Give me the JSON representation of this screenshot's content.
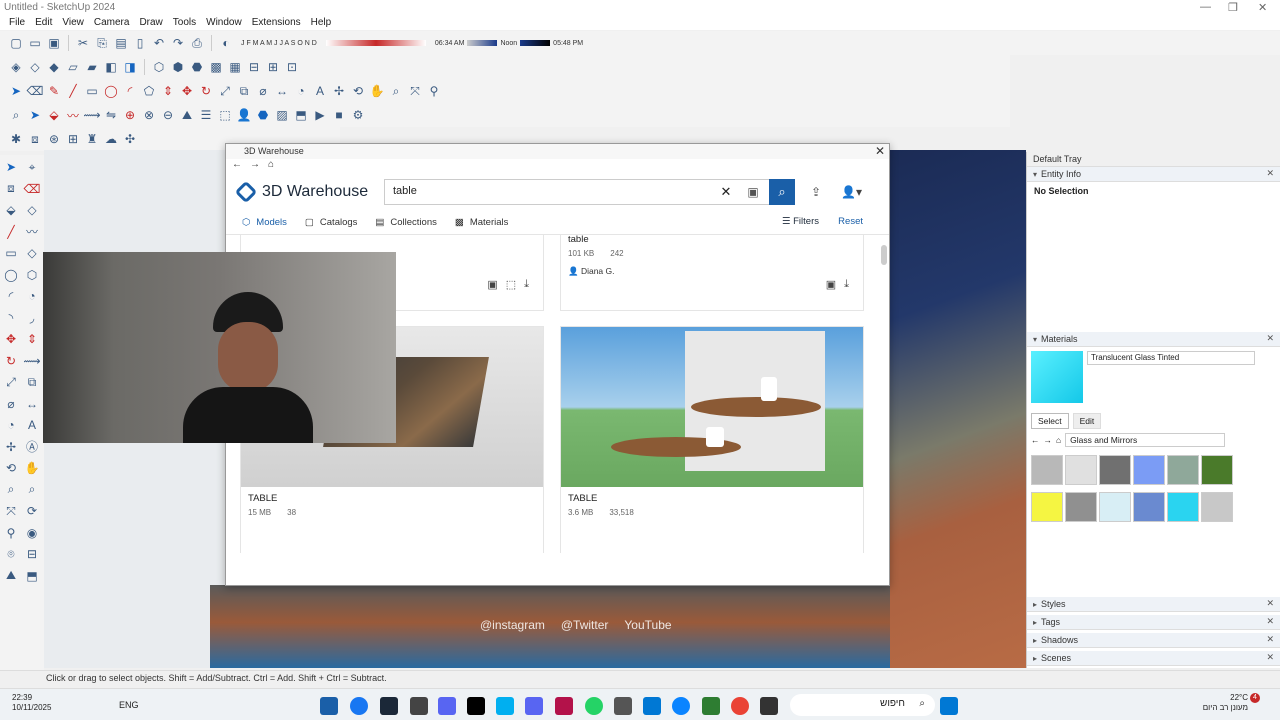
{
  "window": {
    "title": "Untitled - SketchUp 2024"
  },
  "menubar": [
    "File",
    "Edit",
    "View",
    "Camera",
    "Draw",
    "Tools",
    "Window",
    "Extensions",
    "Help"
  ],
  "shadow_bar": {
    "months": "J F M A M J J A S O N D",
    "time_start": "06:34 AM",
    "time_mid": "Noon",
    "time_end": "05:48 PM"
  },
  "warehouse": {
    "window_title": "3D Warehouse",
    "logo_text": "3D Warehouse",
    "search": {
      "value": "table"
    },
    "tabs": [
      {
        "label": "Models",
        "active": true
      },
      {
        "label": "Catalogs",
        "active": false
      },
      {
        "label": "Collections",
        "active": false
      },
      {
        "label": "Materials",
        "active": false
      }
    ],
    "filters_label": "Filters",
    "reset_label": "Reset",
    "results": [
      {
        "name": "table",
        "size": "101 KB",
        "likes": "242",
        "author": "Diana G."
      },
      {
        "name": "TABLE",
        "size": "15 MB",
        "likes": "38"
      },
      {
        "name": "TABLE",
        "size": "3.6 MB",
        "likes": "33,518"
      }
    ]
  },
  "tray": {
    "title": "Default Tray",
    "entity_info": {
      "label": "Entity Info",
      "value": "No Selection"
    },
    "materials": {
      "label": "Materials",
      "current": "Translucent Glass Tinted",
      "tab_select": "Select",
      "tab_edit": "Edit",
      "library": "Glass and Mirrors",
      "swatch_colors": [
        "#b8b8b8",
        "#e0e0e0",
        "#707070",
        "#7b9cf5",
        "#8fa89a",
        "#4a7a2a",
        "#f5f542",
        "#909090",
        "#d8eef5",
        "#6a8ad0",
        "#2ad4f0",
        "#c8c8c8"
      ]
    },
    "collapsed": [
      "Styles",
      "Tags",
      "Shadows",
      "Scenes"
    ]
  },
  "status": {
    "hint": "Click or drag to select objects. Shift = Add/Subtract. Ctrl = Add. Shift + Ctrl = Subtract."
  },
  "social": {
    "instagram": "@instagram",
    "twitter": "@Twitter",
    "youtube": "YouTube"
  },
  "taskbar": {
    "time": "22:39",
    "date": "10/11/2025",
    "lang": "ENG",
    "search_placeholder": "חיפוש",
    "weather_temp": "22°C",
    "weather_desc": "מעונן רב היום",
    "notif_count": "4"
  },
  "colors": {
    "accent": "#1a5fa8",
    "select_tab": "#1a5fa8"
  }
}
